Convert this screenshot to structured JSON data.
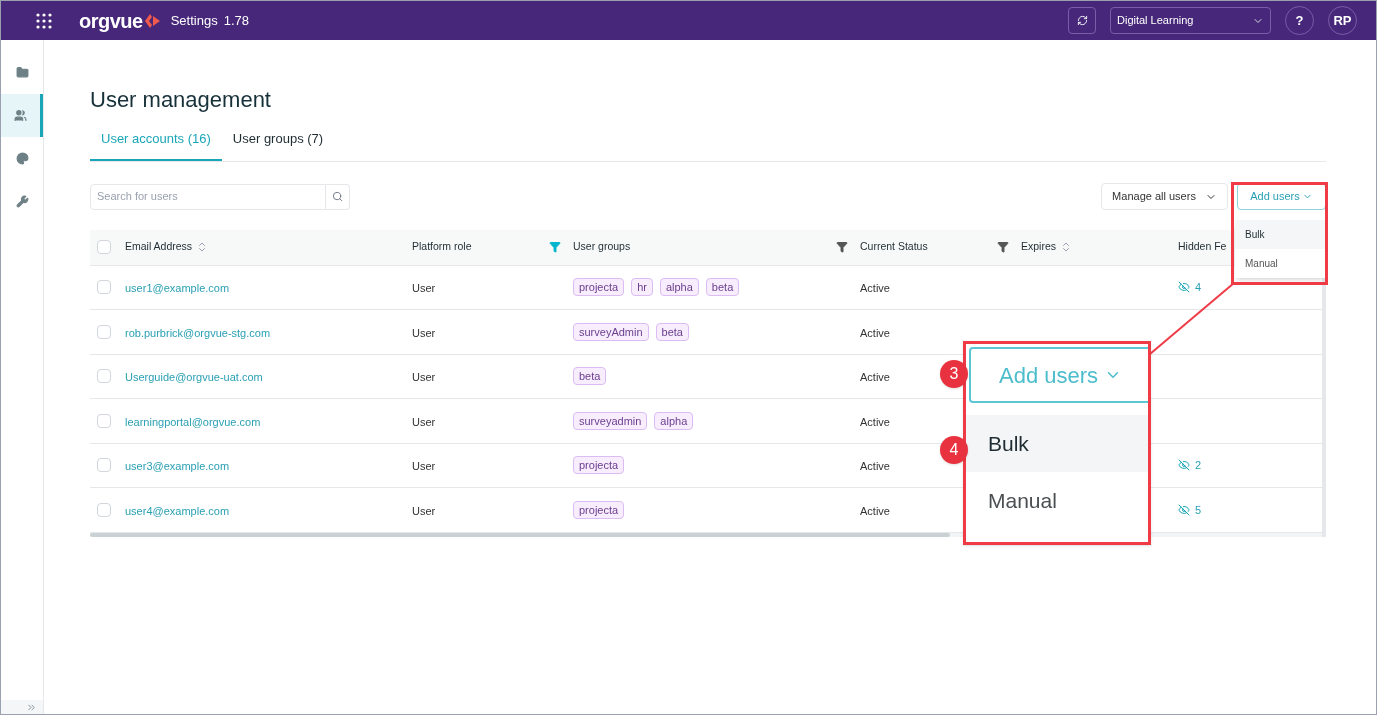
{
  "top_bar": {
    "logo": "orgvue",
    "section": "Settings",
    "version": "1.78",
    "workspace": "Digital Learning",
    "help": "?",
    "avatar": "RP"
  },
  "sidebar": {
    "items": [
      {
        "kind": "folder",
        "selected": false
      },
      {
        "kind": "users",
        "selected": true
      },
      {
        "kind": "palette",
        "selected": false
      },
      {
        "kind": "wrench",
        "selected": false
      }
    ]
  },
  "page_title": "User management",
  "tabs": [
    {
      "label": "User accounts (16)",
      "selected": true
    },
    {
      "label": "User groups (7)",
      "selected": false
    }
  ],
  "search": {
    "placeholder": "Search for users"
  },
  "manage_button": "Manage all users",
  "add_button": "Add users",
  "add_menu": [
    {
      "label": "Bulk",
      "selected": true
    },
    {
      "label": "Manual",
      "selected": false
    }
  ],
  "table": {
    "select_all_checked": false,
    "columns": [
      {
        "label": "Email Address",
        "kind": "sort"
      },
      {
        "label": "Platform role",
        "kind": "filter",
        "active": true
      },
      {
        "label": "User groups",
        "kind": "filter",
        "active": false
      },
      {
        "label": "Current Status",
        "kind": "filter",
        "active": false
      },
      {
        "label": "Expires",
        "kind": "sort"
      },
      {
        "label": "Hidden Fe",
        "kind": "plain"
      }
    ],
    "rows": [
      {
        "checked": false,
        "email": "user1@example.com",
        "role": "User",
        "groups": [
          "projecta",
          "hr",
          "alpha",
          "beta"
        ],
        "status": "Active",
        "hidden": "4"
      },
      {
        "checked": false,
        "email": "rob.purbrick@orgvue-stg.com",
        "role": "User",
        "groups": [
          "surveyAdmin",
          "beta"
        ],
        "status": "Active"
      },
      {
        "checked": false,
        "email": "Userguide@orgvue-uat.com",
        "role": "User",
        "groups": [
          "beta"
        ],
        "status": "Active"
      },
      {
        "checked": false,
        "email": "learningportal@orgvue.com",
        "role": "User",
        "groups": [
          "surveyadmin",
          "alpha"
        ],
        "status": "Active"
      },
      {
        "checked": false,
        "email": "user3@example.com",
        "role": "User",
        "groups": [
          "projecta"
        ],
        "status": "Active",
        "hidden": "2"
      },
      {
        "checked": false,
        "email": "user4@example.com",
        "role": "User",
        "groups": [
          "projecta"
        ],
        "status": "Active",
        "hidden": "5"
      }
    ]
  },
  "callout": {
    "button_marker": "3",
    "button": "Add users",
    "menu_marker": "4",
    "menu": [
      {
        "label": "Bulk",
        "selected": true
      },
      {
        "label": "Manual",
        "selected": false
      }
    ]
  }
}
